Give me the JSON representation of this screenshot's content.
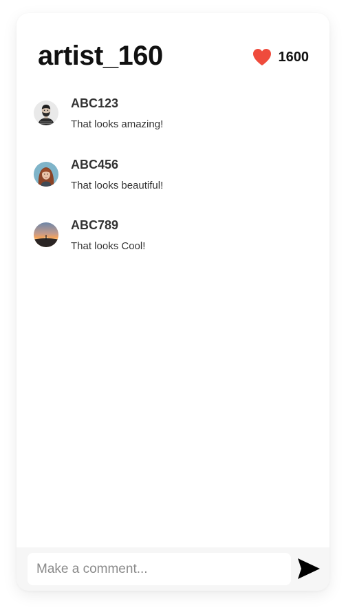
{
  "post": {
    "title": "artist_160",
    "likes": "1600"
  },
  "colors": {
    "heart": "#ef4b3c",
    "text": "#111111",
    "footer_bg": "#f6f6f6"
  },
  "comments": [
    {
      "username": "ABC123",
      "text": "That looks amazing!",
      "avatar": "bearded-man-avatar"
    },
    {
      "username": "ABC456",
      "text": "That looks beautiful!",
      "avatar": "red-haired-woman-avatar"
    },
    {
      "username": "ABC789",
      "text": "That looks Cool!",
      "avatar": "sunset-landscape-avatar"
    }
  ],
  "composer": {
    "placeholder": "Make a comment...",
    "value": ""
  },
  "icons": {
    "like": "heart-icon",
    "send": "send-icon"
  }
}
